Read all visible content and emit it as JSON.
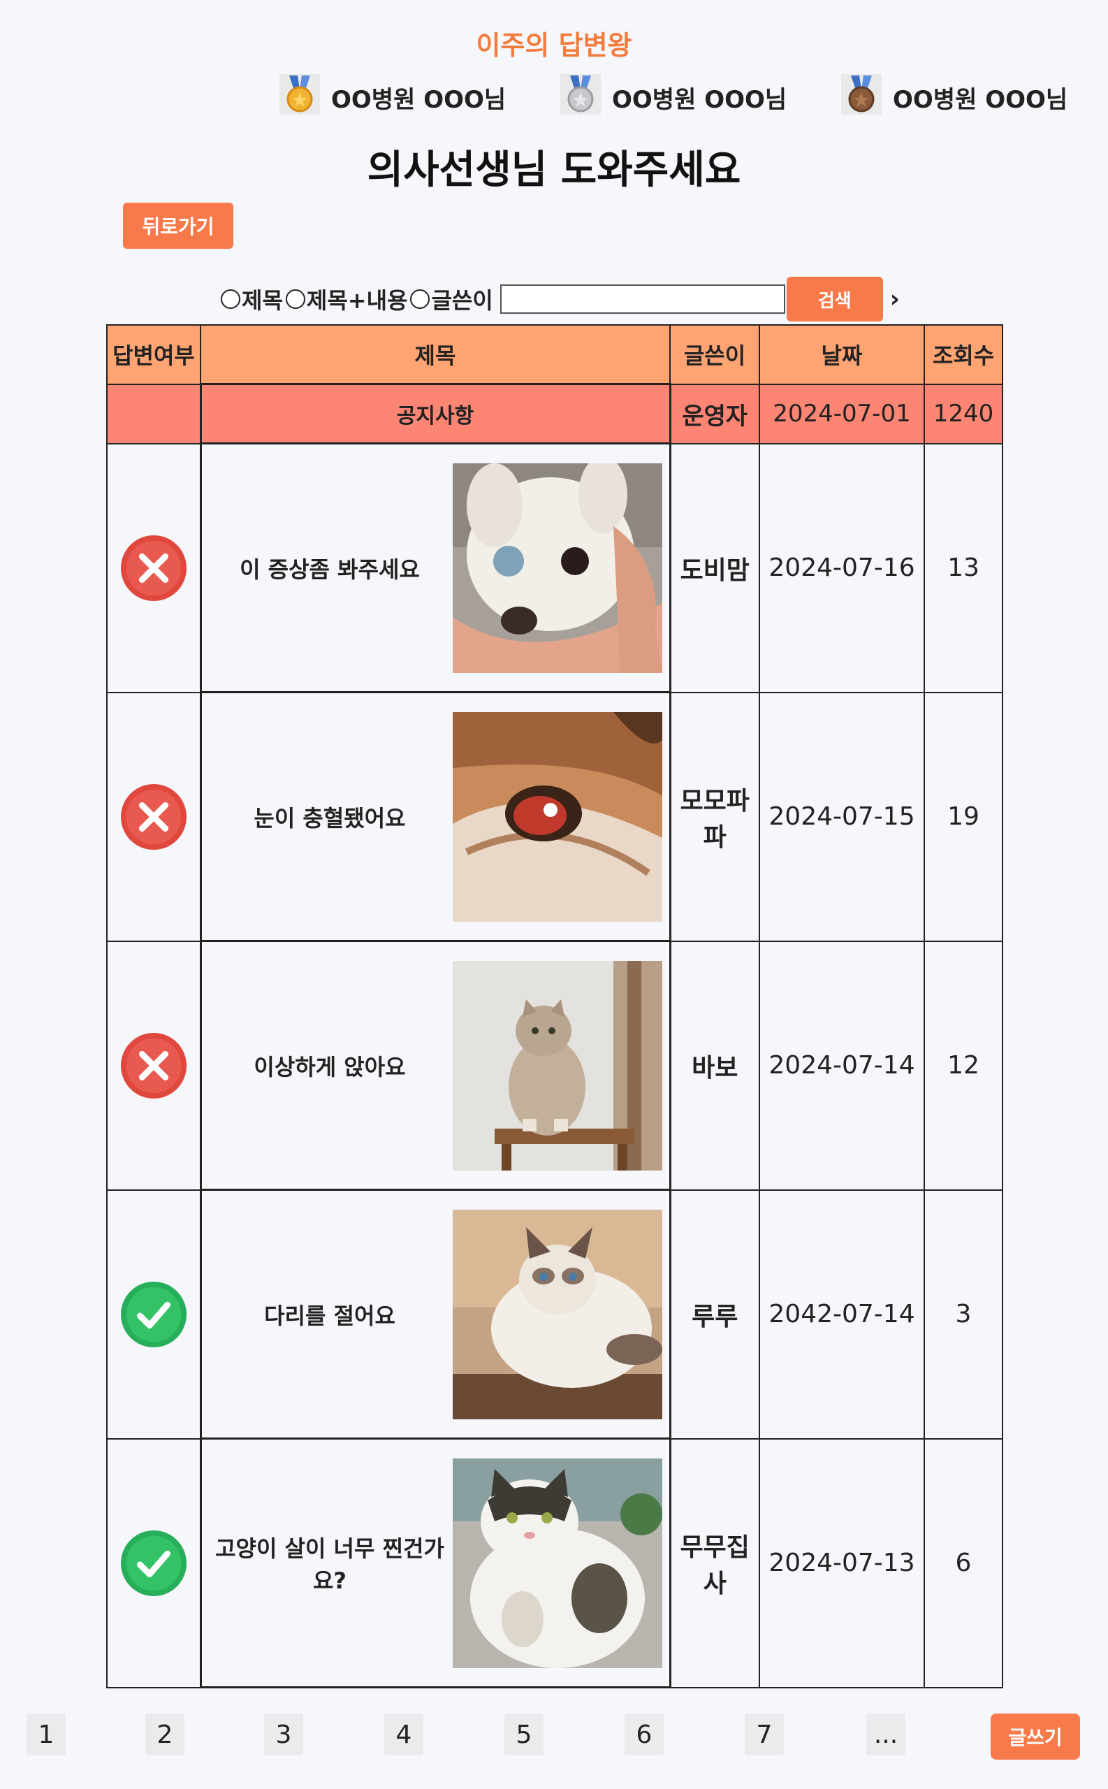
{
  "header": {
    "weekly_title": "이주의 답변왕"
  },
  "medals": [
    {
      "name": "OO병원 OOO님",
      "icon": "gold-medal-icon",
      "color": "#f2b233"
    },
    {
      "name": "OO병원 OOO님",
      "icon": "silver-medal-icon",
      "color": "#c7c9cc"
    },
    {
      "name": "OO병원 OOO님",
      "icon": "bronze-medal-icon",
      "color": "#8a5a3b"
    }
  ],
  "page_title": "의사선생님 도와주세요",
  "back_label": "뒤로가기",
  "search": {
    "options": [
      "제목",
      "제목+내용",
      "글쓴이"
    ],
    "input_value": "",
    "button_label": "검색",
    "next_glyph": "›"
  },
  "table": {
    "headers": [
      "답변여부",
      "제목",
      "글쓴이",
      "날짜",
      "조회수"
    ],
    "notice": {
      "title": "공지사항",
      "author": "운영자",
      "date": "2024-07-01",
      "views": "1240"
    },
    "rows": [
      {
        "answered": false,
        "title": "이 증상좀 봐주세요",
        "image": "white-dog-eye-photo",
        "author": "도비맘",
        "date": "2024-07-16",
        "views": "13"
      },
      {
        "answered": false,
        "title": "눈이 충혈됐어요",
        "image": "dog-red-eye-photo",
        "author": "모모파파",
        "date": "2024-07-15",
        "views": "19"
      },
      {
        "answered": false,
        "title": "이상하게 앉아요",
        "image": "sitting-cat-photo",
        "author": "바보",
        "date": "2024-07-14",
        "views": "12"
      },
      {
        "answered": true,
        "title": "다리를 절어요",
        "image": "ragdoll-cat-photo",
        "author": "루루",
        "date": "2042-07-14",
        "views": "3"
      },
      {
        "answered": true,
        "title": "고양이 살이 너무 찐건가요?",
        "image": "fat-cat-photo",
        "author": "무무집사",
        "date": "2024-07-13",
        "views": "6"
      }
    ]
  },
  "pagination": [
    "1",
    "2",
    "3",
    "4",
    "5",
    "6",
    "7",
    "..."
  ],
  "write_label": "글쓰기",
  "colors": {
    "accent": "#f8794a",
    "header_row": "#ffa472",
    "notice_row": "#fc8574",
    "no": "#e0483e",
    "yes": "#2ebb5e"
  }
}
